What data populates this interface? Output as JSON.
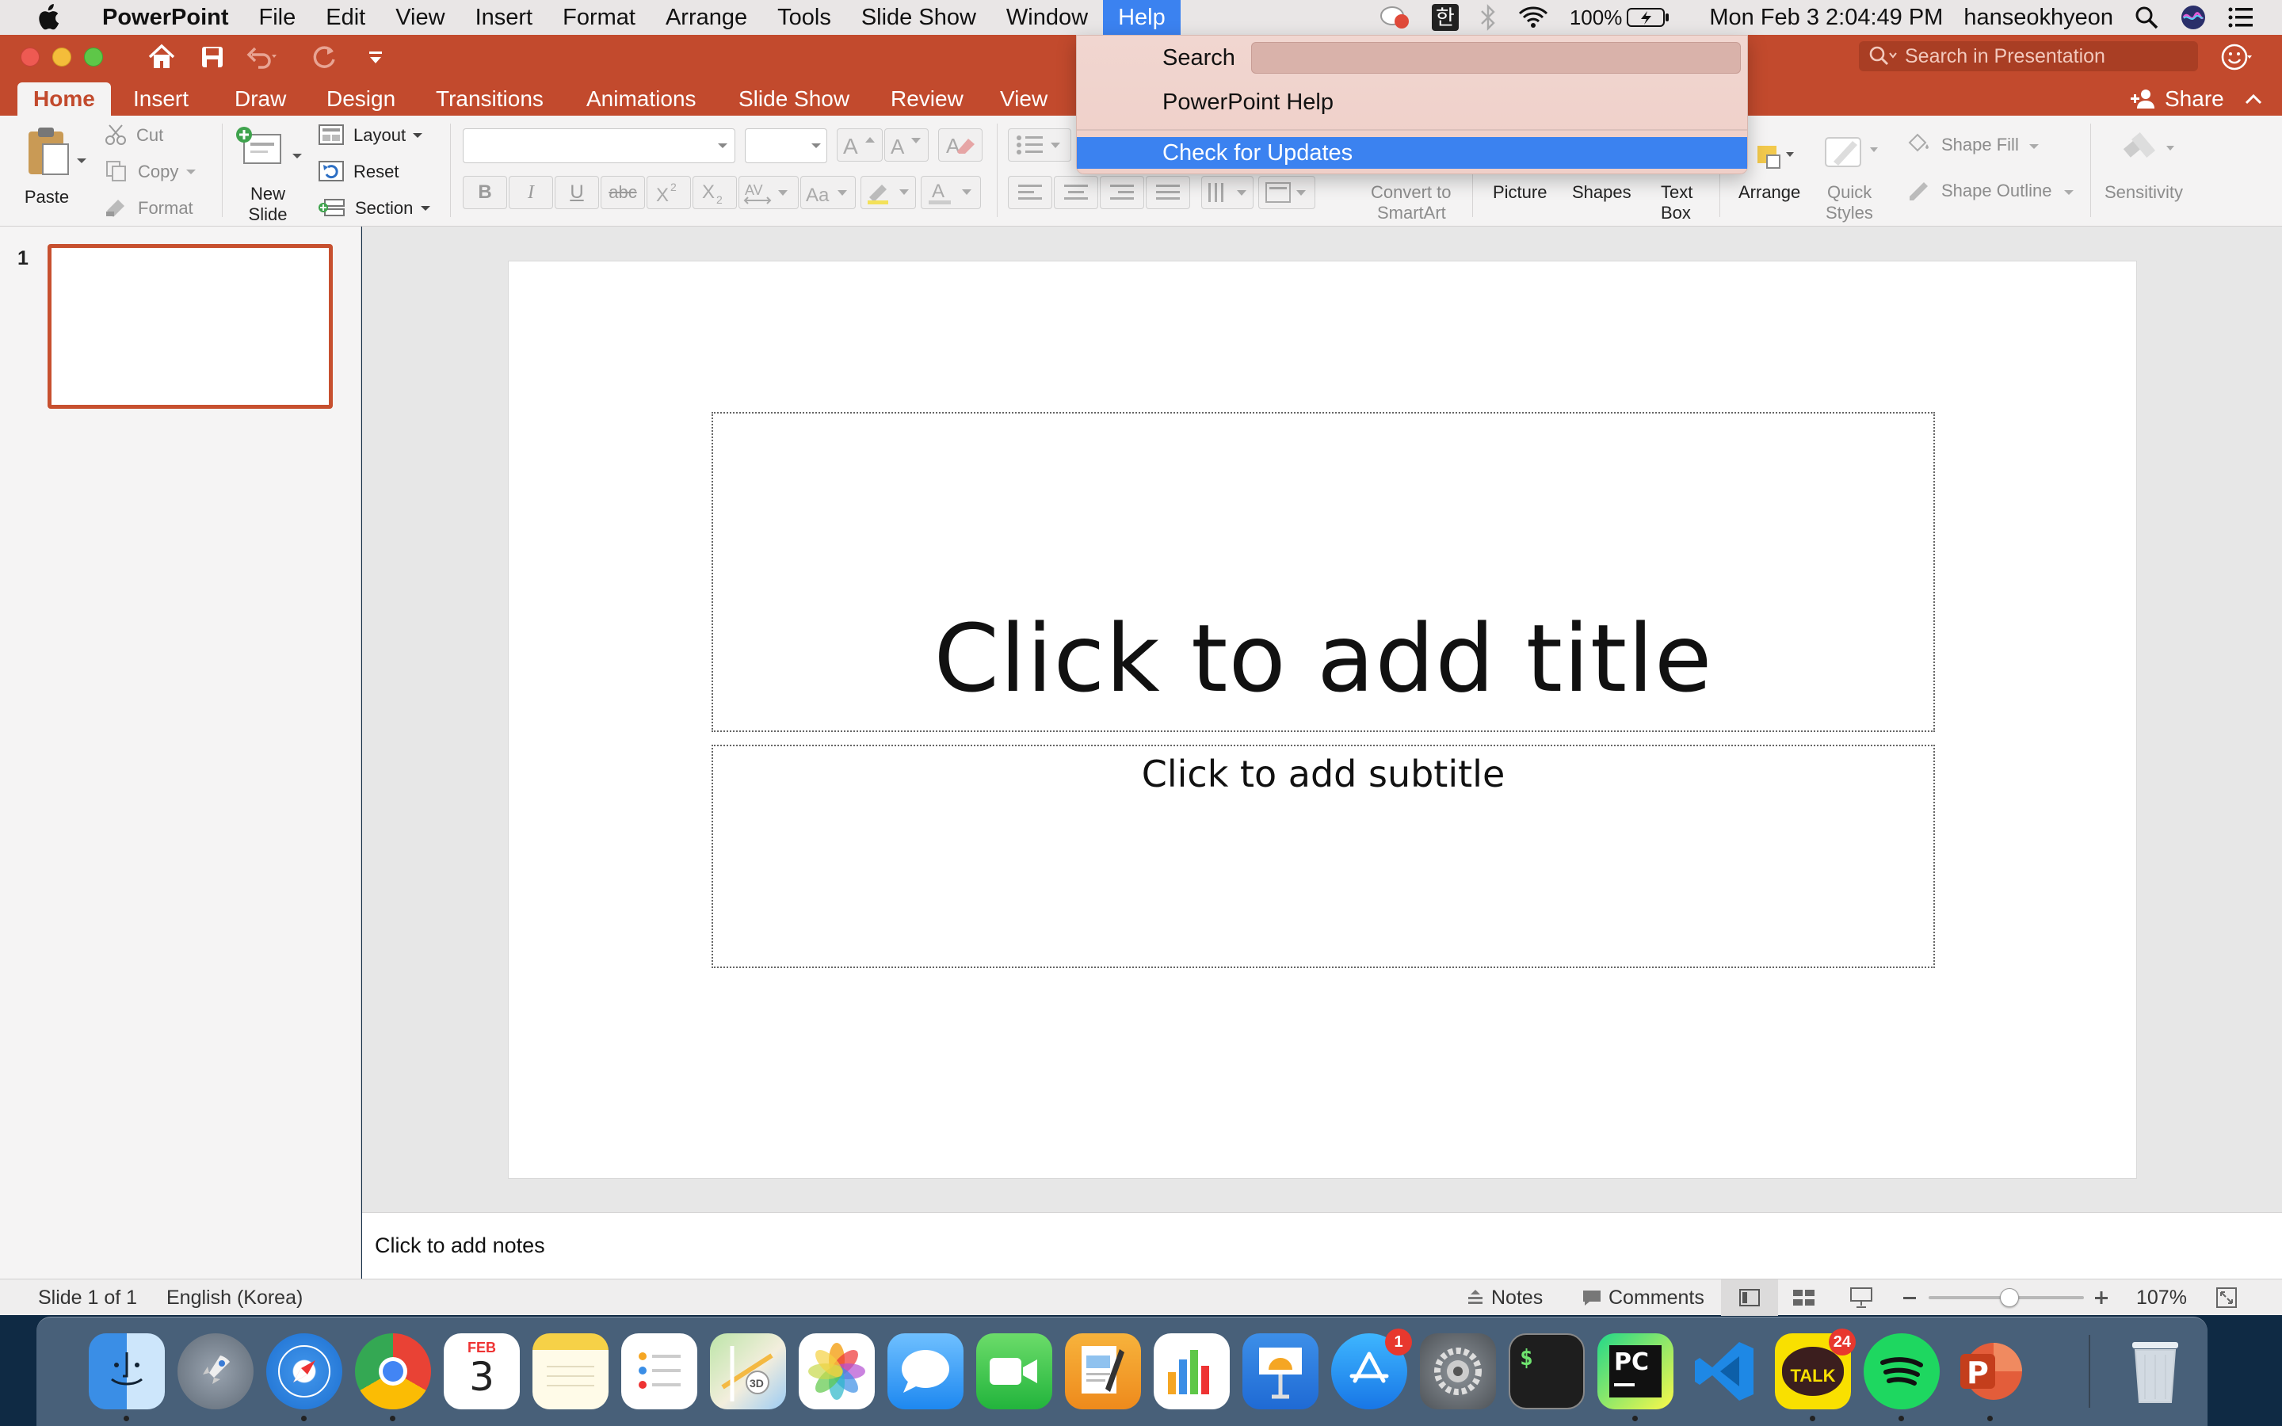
{
  "menubar": {
    "app": "PowerPoint",
    "items": [
      "File",
      "Edit",
      "View",
      "Insert",
      "Format",
      "Arrange",
      "Tools",
      "Slide Show",
      "Window",
      "Help"
    ],
    "active": "Help",
    "input_source": "한",
    "battery": "100%",
    "datetime": "Mon Feb 3  2:04:49 PM",
    "user": "hanseokhyeon"
  },
  "titlebar": {
    "search_placeholder": "Search in Presentation"
  },
  "tabs": [
    "Home",
    "Insert",
    "Draw",
    "Design",
    "Transitions",
    "Animations",
    "Slide Show",
    "Review",
    "View"
  ],
  "active_tab": "Home",
  "share_label": "Share",
  "ribbon": {
    "paste": "Paste",
    "cut": "Cut",
    "copy": "Copy",
    "format": "Format",
    "new_slide_1": "New",
    "new_slide_2": "Slide",
    "layout": "Layout",
    "reset": "Reset",
    "section": "Section",
    "convert_1": "Convert to",
    "convert_2": "SmartArt",
    "picture": "Picture",
    "shapes": "Shapes",
    "textbox_1": "Text",
    "textbox_2": "Box",
    "arrange": "Arrange",
    "quick_1": "Quick",
    "quick_2": "Styles",
    "shape_fill": "Shape Fill",
    "shape_outline": "Shape Outline",
    "sensitivity": "Sensitivity",
    "bold": "B",
    "italic": "I",
    "underline": "U",
    "strike": "abc"
  },
  "help_menu": {
    "search_label": "Search",
    "item_help": "PowerPoint Help",
    "item_updates": "Check for Updates"
  },
  "slide_pane": {
    "number": "1"
  },
  "slide": {
    "title_placeholder": "Click to add title",
    "subtitle_placeholder": "Click to add subtitle"
  },
  "notes_placeholder": "Click to add notes",
  "statusbar": {
    "slide_info": "Slide 1 of 1",
    "language": "English (Korea)",
    "notes": "Notes",
    "comments": "Comments",
    "zoom": "107%"
  },
  "dock": {
    "calendar_month": "FEB",
    "calendar_day": "3",
    "appstore_badge": "1",
    "kakao_label": "TALK",
    "kakao_badge": "24",
    "pycharm_label": "PC",
    "powerpoint_label": "P",
    "terminal_label": "$"
  },
  "colors": {
    "accent": "#c24a2d",
    "menu_highlight": "#3b82f0",
    "ribbon_bg": "#f4f3f3"
  }
}
